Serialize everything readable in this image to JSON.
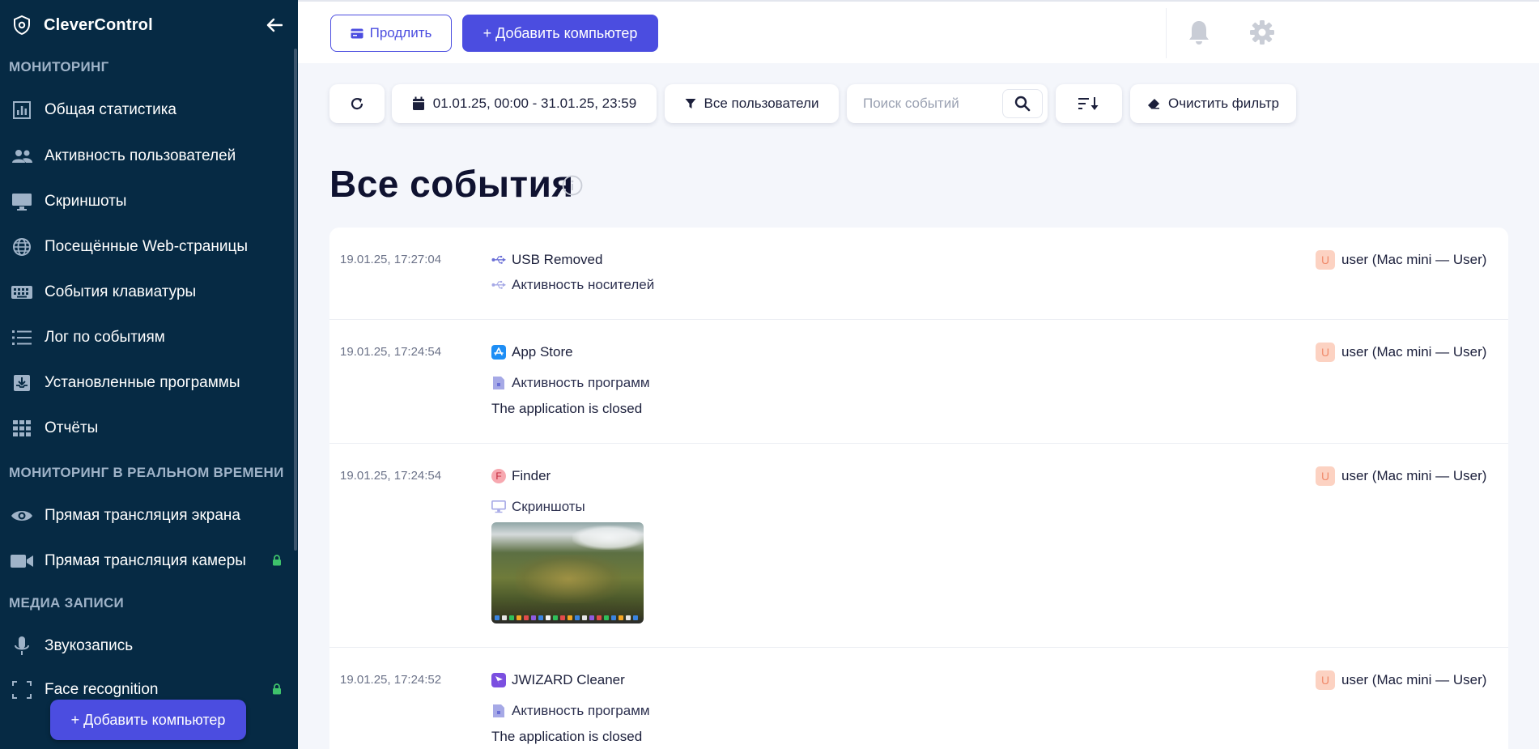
{
  "app": {
    "title": "CleverControl"
  },
  "sidebar": {
    "sections": [
      {
        "title": "МОНИТОРИНГ"
      },
      {
        "title": "МОНИТОРИНГ В РЕАЛЬНОМ ВРЕМЕНИ"
      },
      {
        "title": "МЕДИА ЗАПИСИ"
      }
    ],
    "items": [
      {
        "label": "Общая статистика",
        "icon": "bar-chart-icon"
      },
      {
        "label": "Активность пользователей",
        "icon": "users-icon"
      },
      {
        "label": "Скриншоты",
        "icon": "monitor-icon"
      },
      {
        "label": "Посещённые Web-страницы",
        "icon": "globe-icon"
      },
      {
        "label": "События клавиатуры",
        "icon": "keyboard-icon"
      },
      {
        "label": "Лог по событиям",
        "icon": "list-icon"
      },
      {
        "label": "Установленные программы",
        "icon": "download-box-icon"
      },
      {
        "label": "Отчёты",
        "icon": "grid-icon"
      },
      {
        "label": "Прямая трансляция экрана",
        "icon": "eye-icon"
      },
      {
        "label": "Прямая трансляция камеры",
        "icon": "video-camera-icon",
        "locked": true
      },
      {
        "label": "Звукозапись",
        "icon": "microphone-icon"
      },
      {
        "label": "Face recognition",
        "icon": "face-scan-icon",
        "locked": true
      }
    ],
    "add_button": "+ Добавить компьютер"
  },
  "topbar": {
    "renew_button": "Продлить",
    "add_button": "+ Добавить компьютер"
  },
  "filters": {
    "date_range": "01.01.25, 00:00 - 31.01.25, 23:59",
    "users": "Все пользователи",
    "search_placeholder": "Поиск событий",
    "clear": "Очистить фильтр"
  },
  "page": {
    "title": "Все события"
  },
  "events": [
    {
      "time": "19.01.25, 17:27:04",
      "title": "USB Removed",
      "category": "Активность носителей",
      "user": "user (Mac mini — User)",
      "avatar": "U"
    },
    {
      "time": "19.01.25, 17:24:54",
      "title": "App Store",
      "category": "Активность программ",
      "detail": "The application is closed",
      "user": "user (Mac mini — User)",
      "avatar": "U"
    },
    {
      "time": "19.01.25, 17:24:54",
      "title": "Finder",
      "app_badge": "F",
      "category": "Скриншоты",
      "user": "user (Mac mini — User)",
      "avatar": "U"
    },
    {
      "time": "19.01.25, 17:24:52",
      "title": "JWIZARD Cleaner",
      "category": "Активность программ",
      "detail": "The application is closed",
      "user": "user (Mac mini — User)",
      "avatar": "U"
    }
  ],
  "colors": {
    "sidebar_bg": "#062a44",
    "accent": "#4b4de0",
    "lock": "#3ec26b"
  }
}
